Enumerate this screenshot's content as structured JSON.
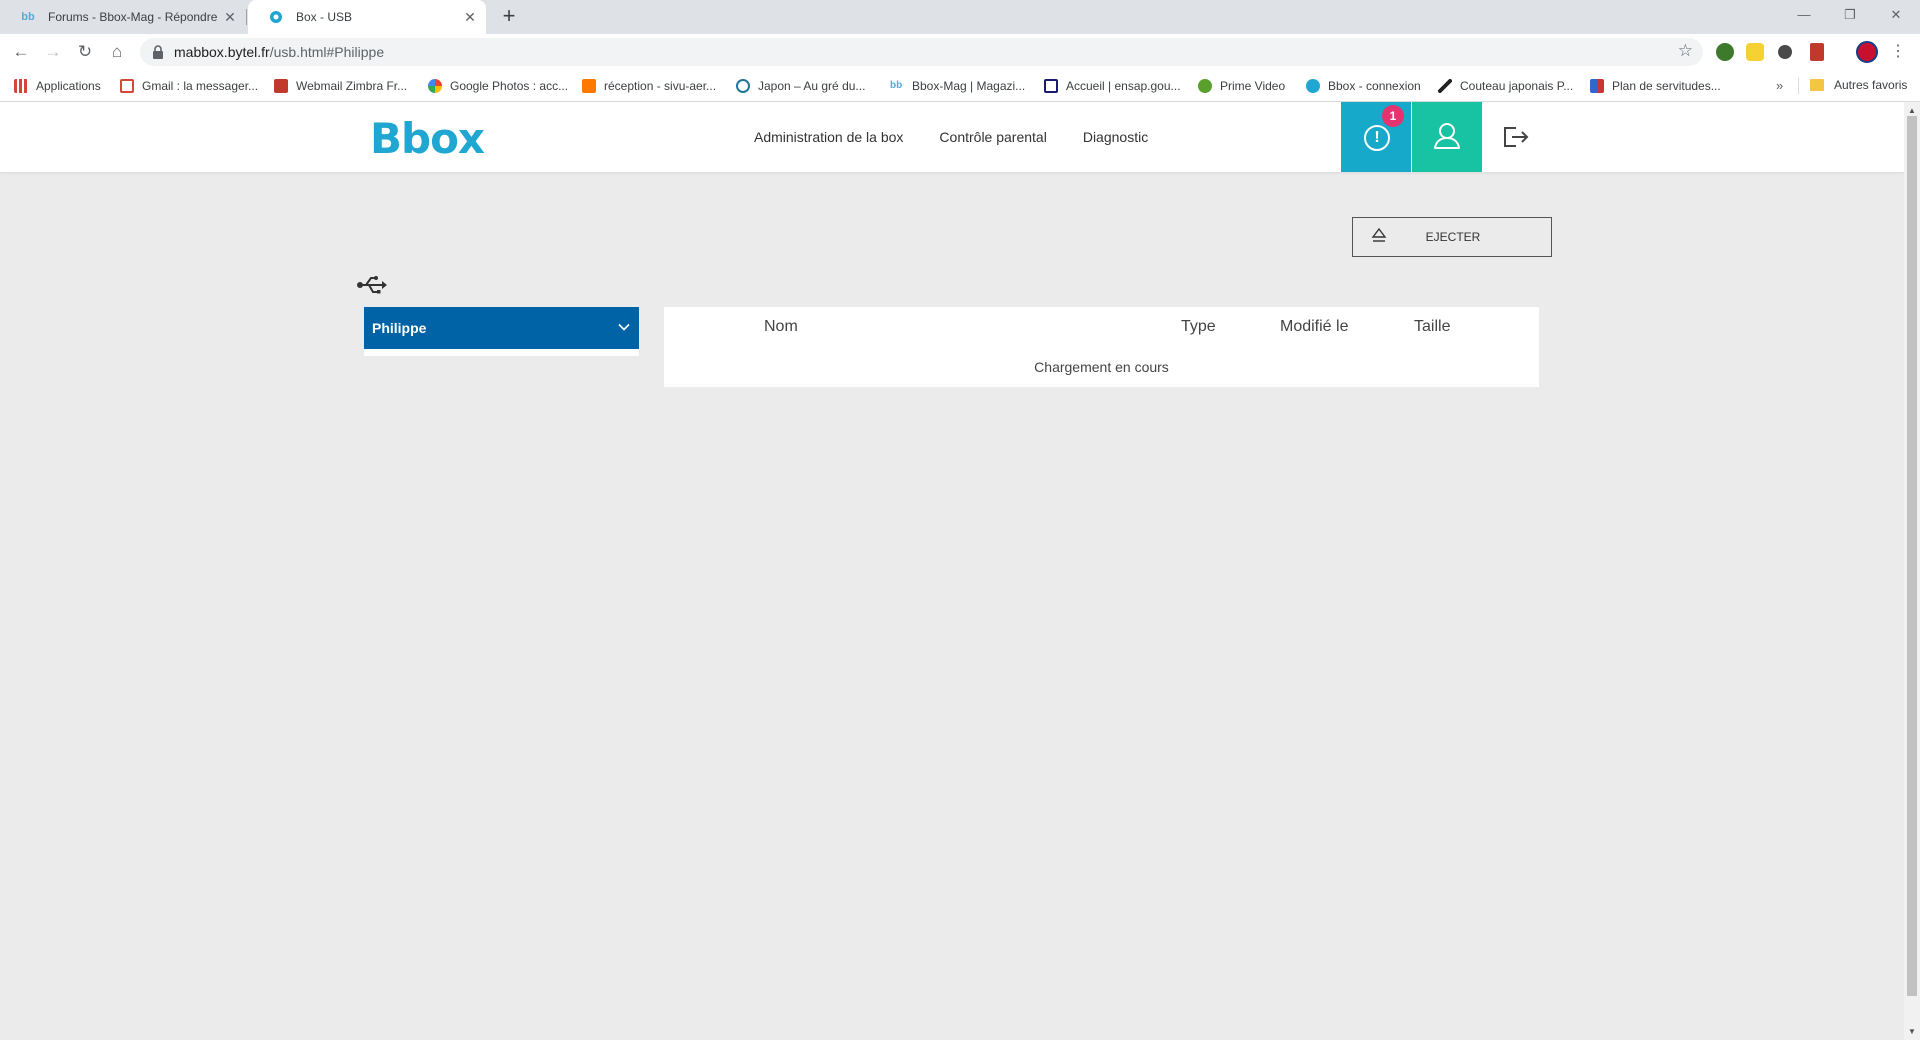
{
  "browser": {
    "tabs": [
      {
        "title": "Forums - Bbox-Mag - Répondre",
        "icon": "bbox-mag-icon",
        "active": false
      },
      {
        "title": "Box - USB",
        "icon": "bouygues-icon",
        "active": true
      }
    ],
    "url": {
      "host": "mabbox.bytel.fr",
      "path": "/usb.html#Philippe"
    },
    "bookmarks": [
      {
        "label": "Applications",
        "icon": "apps-grid-icon",
        "color": "#d44638"
      },
      {
        "label": "Gmail : la messager...",
        "icon": "gmail-icon",
        "color": "#d44638"
      },
      {
        "label": "Webmail Zimbra Fr...",
        "icon": "zimbra-icon",
        "color": "#c0392b"
      },
      {
        "label": "Google Photos : acc...",
        "icon": "google-photos-icon",
        "color": "#fbbc05"
      },
      {
        "label": "réception - sivu-aer...",
        "icon": "orange-mail-icon",
        "color": "#ff7900"
      },
      {
        "label": "Japon – Au gré du...",
        "icon": "wordpress-icon",
        "color": "#21759b"
      },
      {
        "label": "Bbox-Mag | Magazi...",
        "icon": "bbox-mag-icon",
        "color": "#5aa9d6"
      },
      {
        "label": "Accueil | ensap.gou...",
        "icon": "ensap-icon",
        "color": "#1a1a6e"
      },
      {
        "label": "Prime Video",
        "icon": "prime-video-icon",
        "color": "#5aa02c"
      },
      {
        "label": "Bbox - connexion",
        "icon": "bouygues-icon",
        "color": "#1fa7d1"
      },
      {
        "label": "Couteau japonais P...",
        "icon": "knife-icon",
        "color": "#222222"
      },
      {
        "label": "Plan de servitudes...",
        "icon": "plan-icon",
        "color": "#3366cc"
      }
    ],
    "bookmarks_more": "»",
    "other_bookmarks": "Autres favoris"
  },
  "header": {
    "logo": "Bbox",
    "nav": [
      "Administration de la box",
      "Contrôle parental",
      "Diagnostic"
    ],
    "alert_badge": "1",
    "alert_symbol": "!"
  },
  "content": {
    "eject_label": "EJECTER",
    "device_selected": "Philippe",
    "columns": {
      "name": "Nom",
      "type": "Type",
      "modified": "Modifié le",
      "size": "Taille"
    },
    "loading_text": "Chargement en cours"
  },
  "colors": {
    "brand": "#1fa7d1",
    "alert_bg": "#17a9c9",
    "user_bg": "#17c3a3",
    "badge": "#e6336f",
    "select_bg": "#0063a6"
  }
}
